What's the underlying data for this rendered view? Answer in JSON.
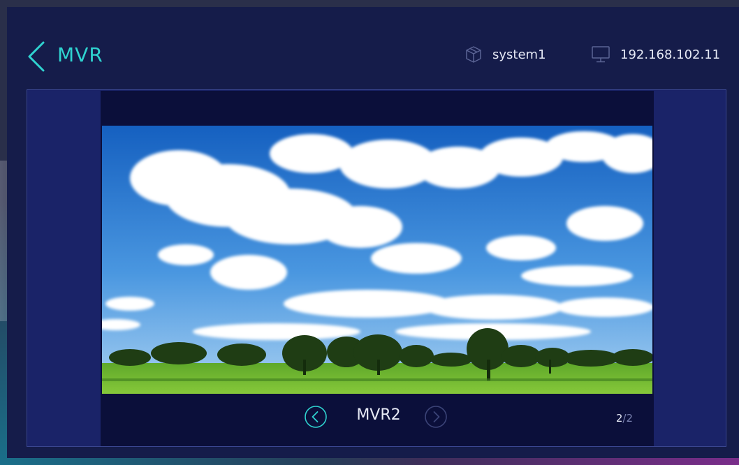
{
  "header": {
    "title": "MVR",
    "system_name": "system1",
    "ip_address": "192.168.102.11"
  },
  "viewer": {
    "current_name": "MVR2",
    "page_current": "2",
    "page_separator": "/",
    "page_total": "2"
  },
  "icons": {
    "back": "chevron-left-icon",
    "system": "cube-icon",
    "network": "monitor-icon",
    "prev": "circle-chevron-left-icon",
    "next": "circle-chevron-right-icon"
  },
  "colors": {
    "accent": "#2fd3d0",
    "app_background": "#151c4a",
    "panel_background": "#1a2368",
    "viewer_background": "#0b0f3a",
    "text": "#e6e9f5",
    "muted": "#7a82b0"
  }
}
